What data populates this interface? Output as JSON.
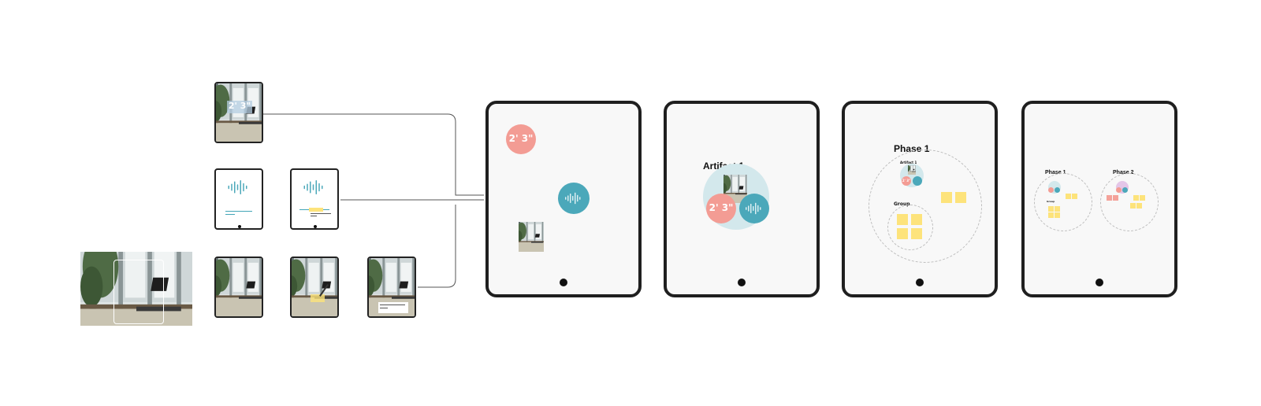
{
  "colors": {
    "frame": "#1f1f1f",
    "screen": "#f8f8f8",
    "coral": "#f39c94",
    "teal": "#4ba8ba",
    "light_teal": "#d3e8ec",
    "sticky": "#fde37b",
    "connector": "#555555"
  },
  "icons": [
    "soundwave-icon",
    "photo-thumbnail",
    "home-button"
  ],
  "source_cards": {
    "time_badge": "2' 3\"",
    "caption_text": "Lorem ipsum dolor sit amet",
    "highlight_word": "dolor sit"
  },
  "screens": {
    "screen1": {
      "time_bubble": "2' 3\""
    },
    "screen2": {
      "title": "Artifact 1",
      "time_bubble": "2' 3\""
    },
    "screen3": {
      "phase_title": "Phase 1",
      "artifact_label": "Artifact 1",
      "group_label": "Group",
      "mini_time": "2' 3\""
    },
    "screen4": {
      "phase1_title": "Phase 1",
      "phase2_title": "Phase 2",
      "group_label": "Group"
    }
  }
}
